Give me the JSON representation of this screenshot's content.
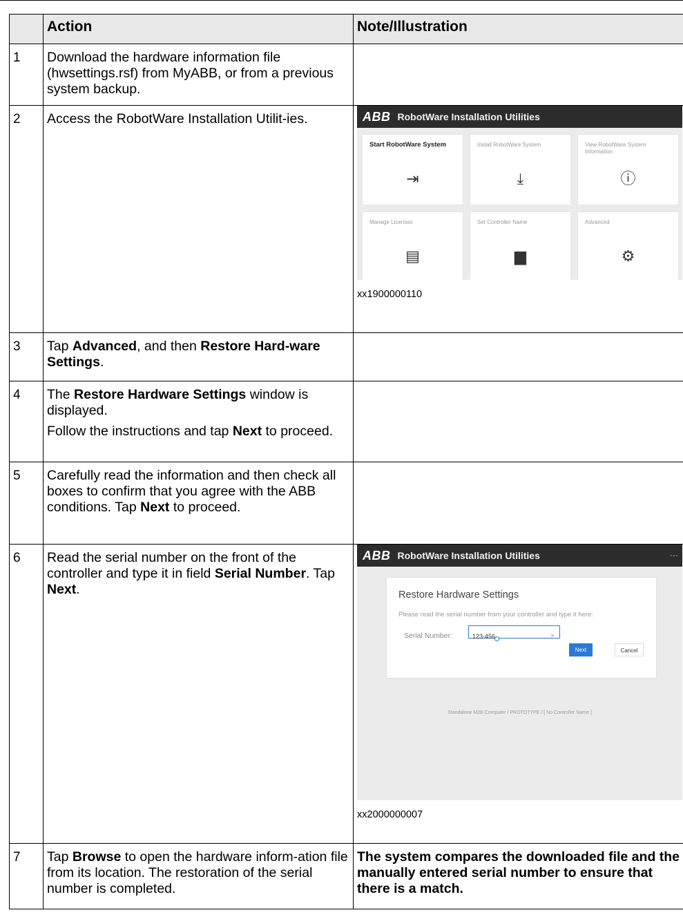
{
  "table": {
    "headers": [
      "",
      "Action",
      "Note/Illustration"
    ],
    "rows": [
      {
        "num": "1",
        "action": [
          {
            "t": "Download the hardware information file (hwsettings.rsf) from MyABB, or from a previous system backup."
          }
        ]
      },
      {
        "num": "2",
        "action": [
          {
            "t": "Access the RobotWare Installation Utilit-ies."
          }
        ]
      },
      {
        "num": "3",
        "action": [
          {
            "t": "Tap "
          },
          {
            "t": "Advanced",
            "b": true
          },
          {
            "t": ", and then "
          },
          {
            "t": "Restore Hard-ware Settings",
            "b": true
          },
          {
            "t": "."
          }
        ]
      },
      {
        "num": "4",
        "action": [
          {
            "t": "The "
          },
          {
            "t": "Restore Hardware Settings",
            "b": true
          },
          {
            "t": " window is displayed."
          }
        ],
        "action2": [
          {
            "t": "Follow the instructions and tap "
          },
          {
            "t": "Next",
            "b": true
          },
          {
            "t": " to proceed."
          }
        ]
      },
      {
        "num": "5",
        "action": [
          {
            "t": "Carefully read the information and then check all boxes to confirm that you agree with the ABB conditions. Tap "
          },
          {
            "t": "Next",
            "b": true
          },
          {
            "t": " to proceed."
          }
        ]
      },
      {
        "num": "6",
        "action": [
          {
            "t": "Read the serial number on the front of the controller and type it in field "
          },
          {
            "t": "Serial Number",
            "b": true
          },
          {
            "t": ". Tap "
          },
          {
            "t": "Next",
            "b": true
          },
          {
            "t": "."
          }
        ]
      },
      {
        "num": "7",
        "action": [
          {
            "t": "Tap "
          },
          {
            "t": "Browse",
            "b": true
          },
          {
            "t": " to open the hardware inform-ation file from its location. The restoration of the serial number is completed."
          }
        ],
        "note": "The system compares the downloaded file and the manually entered serial number to ensure that there is a match."
      }
    ]
  },
  "figure1": {
    "brand": "ABB",
    "title": "RobotWare Installation Utilities",
    "tiles": [
      {
        "label": "Start RobotWare System",
        "icon": "⇥",
        "icon_name": "enter-icon"
      },
      {
        "label": "Install RobotWare System",
        "icon": "⤓",
        "icon_name": "download-icon"
      },
      {
        "label": "View RobotWare System Information",
        "icon": "ⓘ",
        "icon_name": "info-icon"
      },
      {
        "label": "Manage Licenses",
        "icon": "▤",
        "icon_name": "license-icon"
      },
      {
        "label": "Set Controller Name",
        "icon": "▆",
        "icon_name": "controller-icon"
      },
      {
        "label": "Advanced",
        "icon": "⚙",
        "icon_name": "gear-icon"
      }
    ],
    "caption": "xx1900000110"
  },
  "figure2": {
    "brand": "ABB",
    "title": "RobotWare Installation Utilities",
    "menu": "···",
    "dialog_title": "Restore Hardware Settings",
    "instruction": "Please read the serial number from your controller and type it here:",
    "serial_label": "Serial Number:",
    "serial_value": "123-456",
    "clear": "×",
    "next": "Next",
    "cancel": "Cancel",
    "status": "Standalone M2B Computer / PROTOTYPE / [ No Controller Name ]",
    "caption": "xx2000000007"
  }
}
